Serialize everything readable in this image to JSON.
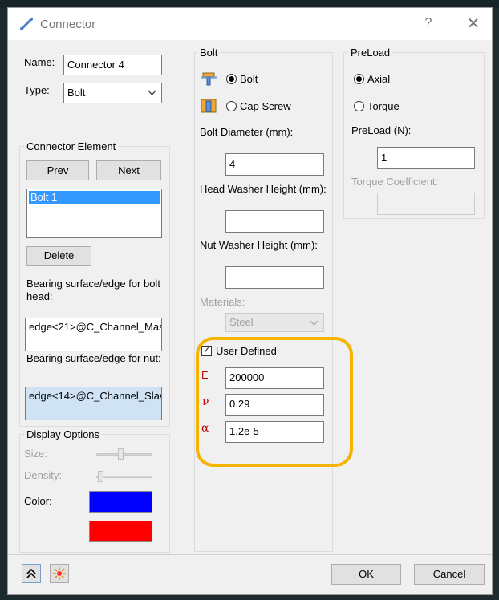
{
  "window": {
    "title": "Connector",
    "help": "?",
    "close": "✕"
  },
  "left": {
    "name_label": "Name:",
    "name_value": "Connector 4",
    "type_label": "Type:",
    "type_value": "Bolt",
    "connector_element": {
      "title": "Connector Element",
      "prev": "Prev",
      "next": "Next",
      "items": [
        "Bolt 1"
      ],
      "delete": "Delete",
      "head_label": "Bearing surface/edge for bolt head:",
      "head_value": "edge<21>@C_Channel_Mas",
      "nut_label": "Bearing surface/edge for nut:",
      "nut_value": "edge<14>@C_Channel_Slav"
    },
    "display": {
      "title": "Display Options",
      "size_label": "Size:",
      "density_label": "Density:",
      "color_label": "Color:",
      "color1": "#0000ff",
      "color2": "#ff0000"
    }
  },
  "bolt": {
    "title": "Bolt",
    "opt_bolt": "Bolt",
    "opt_cap": "Cap Screw",
    "diameter_label": "Bolt Diameter (mm):",
    "diameter_value": "4",
    "head_washer_label": "Head Washer Height (mm):",
    "head_washer_value": "",
    "nut_washer_label": "Nut Washer Height (mm):",
    "nut_washer_value": "",
    "materials_label": "Materials:",
    "materials_value": "Steel",
    "user_defined": "User Defined",
    "e_symbol": "E",
    "e_value": "200000",
    "nu_symbol": "ν",
    "nu_value": "0.29",
    "alpha_symbol": "α",
    "alpha_value": "1.2e-5"
  },
  "preload": {
    "title": "PreLoad",
    "opt_axial": "Axial",
    "opt_torque": "Torque",
    "preload_label": "PreLoad (N):",
    "preload_value": "1",
    "torque_coef_label": "Torque Coefficient:",
    "torque_coef_value": ""
  },
  "footer": {
    "ok": "OK",
    "cancel": "Cancel"
  },
  "accent": "#f5b400"
}
